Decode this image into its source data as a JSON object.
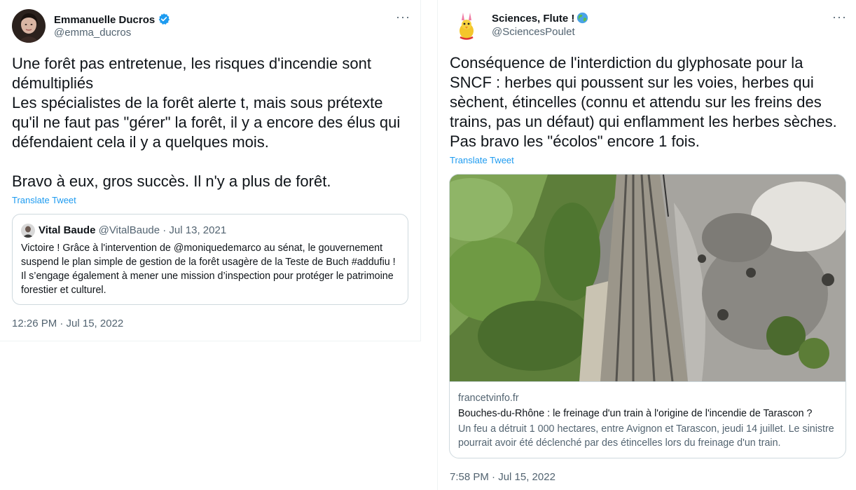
{
  "left_tweet": {
    "author_name": "Emmanuelle Ducros",
    "author_handle": "@emma_ducros",
    "more_label": "···",
    "body": "Une forêt pas entretenue, les risques d'incendie sont démultipliés\nLes spécialistes de la forêt alerte t, mais sous prétexte qu'il ne faut pas \"gérer\" la forêt, il y a encore des élus qui défendaient cela il y a quelques mois.\n\nBravo à eux, gros succès. Il n'y a plus de forêt.",
    "translate_label": "Translate Tweet",
    "quote": {
      "author_name": "Vital Baude",
      "author_meta": "@VitalBaude · Jul 13, 2021",
      "text": "Victoire ! Grâce à l'intervention de @moniquedemarco au sénat, le gouvernement suspend le plan simple de gestion de la forêt usagère de la Teste de Buch #adduﬁu ! Il s’engage également à mener une mission d’inspection pour protéger le patrimoine forestier et culturel."
    },
    "timestamp": "12:26 PM · Jul 15, 2022"
  },
  "right_tweet": {
    "author_name": "Sciences, Flute !",
    "author_handle": "@SciencesPoulet",
    "more_label": "···",
    "body": "Conséquence de l'interdiction du glyphosate pour la SNCF : herbes qui poussent sur les voies, herbes qui sèchent, étincelles (connu et attendu sur les freins des trains, pas un défaut) qui enflamment les herbes sèches. Pas bravo les \"écolos\" encore 1 fois.",
    "translate_label": "Translate Tweet",
    "card": {
      "domain": "francetvinfo.fr",
      "title": "Bouches-du-Rhône : le freinage d'un train à l'origine de l'incendie de Tarascon ?",
      "description": "Un feu a détruit 1 000 hectares, entre Avignon et Tarascon, jeudi 14 juillet. Le sinistre pourrait avoir été déclenché par des étincelles lors du freinage d'un train."
    },
    "timestamp": "7:58 PM · Jul 15, 2022"
  },
  "colors": {
    "text": "#0f1419",
    "secondary": "#536471",
    "link": "#1d9bf0",
    "border": "#cfd9de"
  }
}
